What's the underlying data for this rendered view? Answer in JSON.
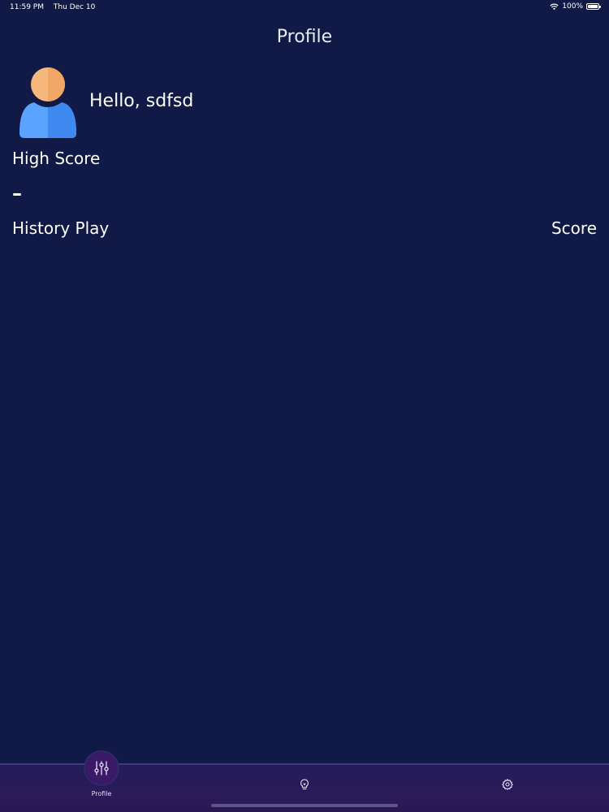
{
  "status_bar": {
    "time": "11:59 PM",
    "date": "Thu Dec 10",
    "battery": "100%",
    "icons": [
      "wifi-icon",
      "battery-icon"
    ]
  },
  "header": {
    "title": "Profile"
  },
  "profile": {
    "greeting": "Hello, sdfsd",
    "avatar_icon": "user-avatar-icon"
  },
  "high_score": {
    "label": "High Score",
    "value": "–"
  },
  "history": {
    "label": "History Play",
    "score_label": "Score"
  },
  "tab_bar": {
    "tabs": [
      {
        "label": "Profile",
        "icon": "sliders-icon",
        "active": true
      },
      {
        "label": "",
        "icon": "lightbulb-icon",
        "active": false
      },
      {
        "label": "",
        "icon": "gear-icon",
        "active": false
      }
    ]
  },
  "colors": {
    "background": "#111a46",
    "tab_bar": "#261b58",
    "active_bubble": "#3a1a66",
    "avatar_skin": "#f7b77a",
    "avatar_body": "#4a95f5"
  }
}
